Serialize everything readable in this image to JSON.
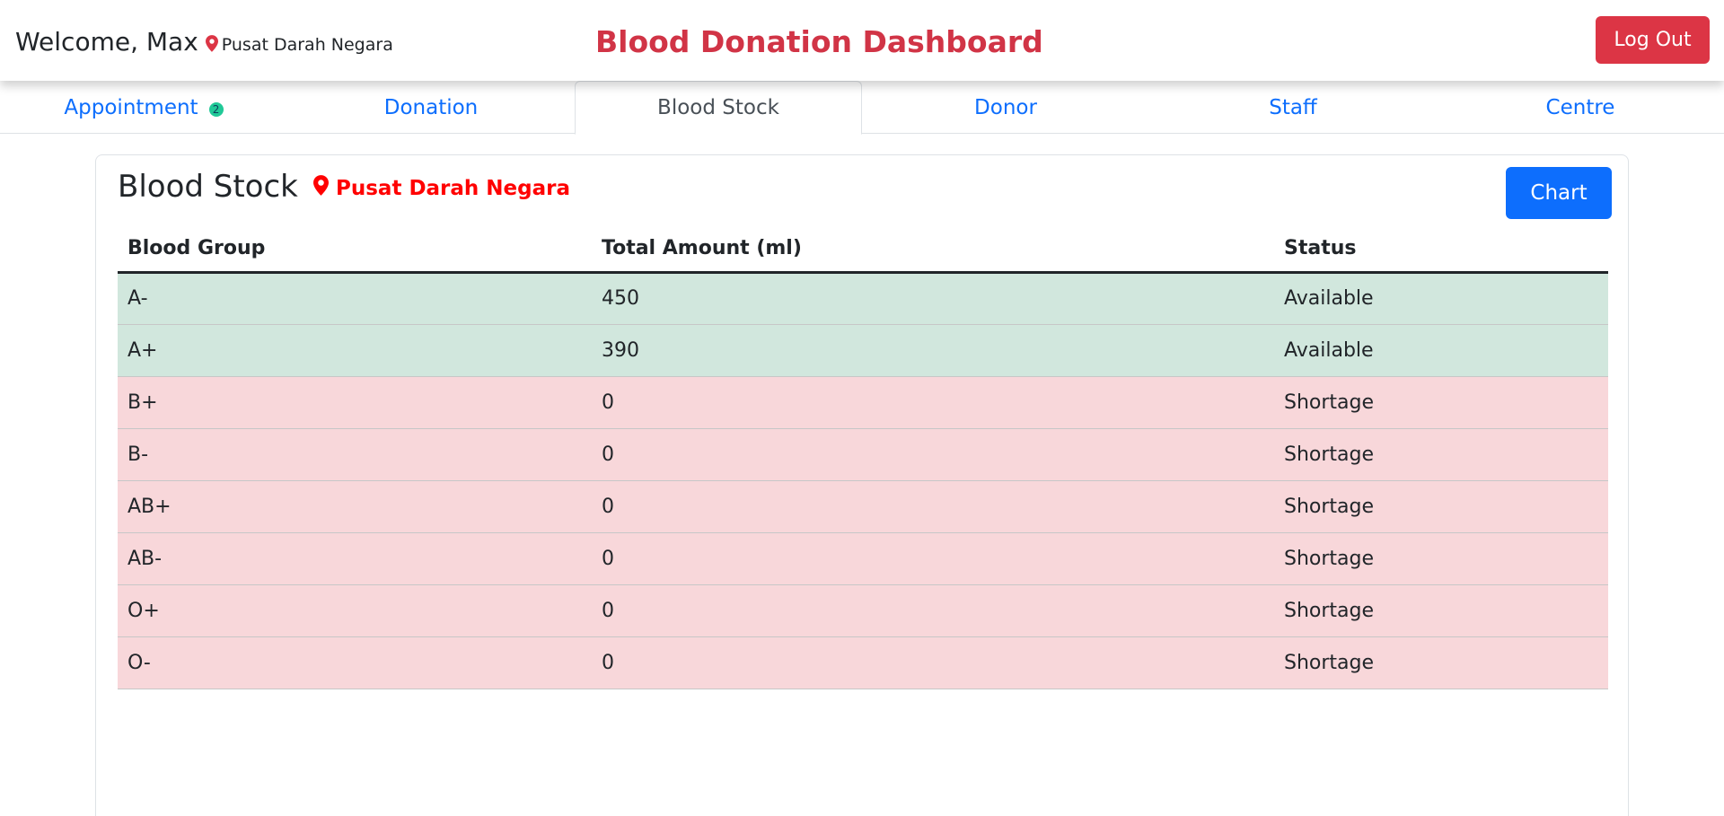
{
  "header": {
    "welcome": "Welcome, Max",
    "location": "Pusat Darah Negara",
    "title": "Blood Donation Dashboard",
    "logout_label": "Log Out"
  },
  "tabs": [
    {
      "label": "Appointment",
      "badge": "2"
    },
    {
      "label": "Donation"
    },
    {
      "label": "Blood Stock",
      "active": true
    },
    {
      "label": "Donor"
    },
    {
      "label": "Staff"
    },
    {
      "label": "Centre"
    }
  ],
  "card": {
    "title": "Blood Stock",
    "location": "Pusat Darah Negara",
    "chart_label": "Chart"
  },
  "table": {
    "headers": [
      "Blood Group",
      "Total Amount (ml)",
      "Status"
    ],
    "rows": [
      {
        "group": "A-",
        "amount": "450",
        "status": "Available"
      },
      {
        "group": "A+",
        "amount": "390",
        "status": "Available"
      },
      {
        "group": "B+",
        "amount": "0",
        "status": "Shortage"
      },
      {
        "group": "B-",
        "amount": "0",
        "status": "Shortage"
      },
      {
        "group": "AB+",
        "amount": "0",
        "status": "Shortage"
      },
      {
        "group": "AB-",
        "amount": "0",
        "status": "Shortage"
      },
      {
        "group": "O+",
        "amount": "0",
        "status": "Shortage"
      },
      {
        "group": "O-",
        "amount": "0",
        "status": "Shortage"
      }
    ]
  },
  "colors": {
    "brand_red": "#d13446",
    "logout_red": "#dc3545",
    "primary_blue": "#0d6efd",
    "location_red": "#ff0000",
    "available_bg": "#d1e7dd",
    "shortage_bg": "#f8d7da",
    "badge_teal": "#20c997"
  },
  "icons": {
    "location": "map-pin-icon"
  }
}
